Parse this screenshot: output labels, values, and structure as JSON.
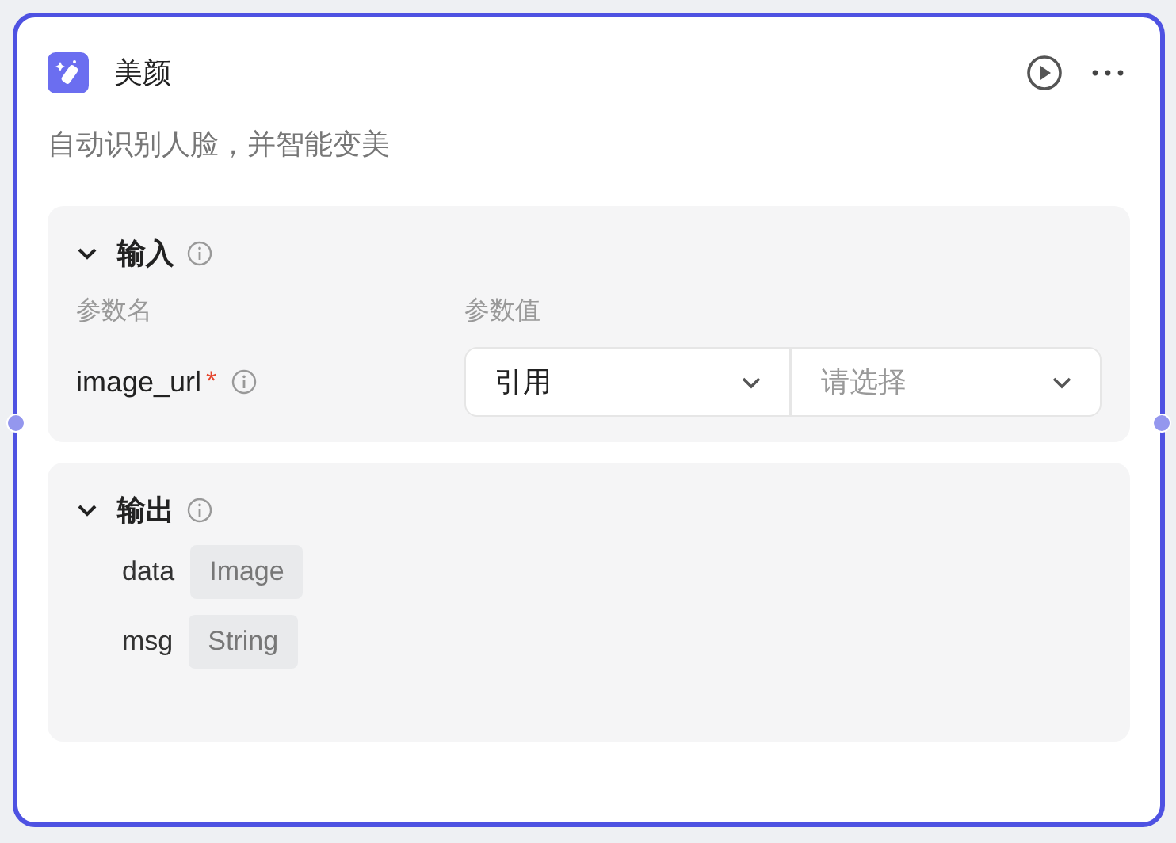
{
  "node": {
    "title": "美颜",
    "description": "自动识别人脸，并智能变美"
  },
  "input": {
    "title": "输入",
    "expanded": true,
    "columns": [
      "参数名",
      "参数值"
    ],
    "params": [
      {
        "name": "image_url",
        "required_mark": "*",
        "source": "引用",
        "placeholder": "请选择"
      }
    ]
  },
  "output": {
    "title": "输出",
    "expanded": true,
    "fields": [
      {
        "name": "data",
        "type": "Image"
      },
      {
        "name": "msg",
        "type": "String"
      }
    ]
  }
}
